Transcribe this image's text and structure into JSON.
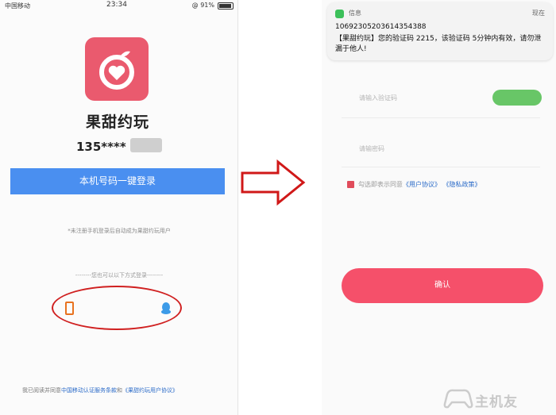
{
  "status_bar": {
    "carrier": "中国移动",
    "time": "23:34",
    "battery": "@ 91%"
  },
  "left_screen": {
    "app_name": "果甜约玩",
    "phone_number": "135****",
    "login_button": "本机号码一键登录",
    "auto_register_note": "*未注册手机登录后自动成为果甜约玩用户",
    "other_login_divider": "--------您也可以以下方式登录--------",
    "agreement": {
      "prefix": "我已阅读并同意",
      "link1": "中国移动认证服务条款",
      "middle": "和",
      "link2": "《果甜约玩用户协议》"
    },
    "icons": {
      "logo": "apple-heart-logo-icon",
      "phone_login": "phone-icon",
      "qq_login": "qq-penguin-icon"
    }
  },
  "sms": {
    "app": "信息",
    "time": "现在",
    "sender": "10692305203614354388",
    "body": "【果甜约玩】您的验证码 2215，该验证码 5分钟内有效，请勿泄漏于他人!"
  },
  "right_screen": {
    "code_placeholder": "请输入验证码",
    "password_placeholder": "请输密码",
    "agree_text": "勾选即表示同意",
    "agree_link1": "《用户协议》",
    "agree_link2": "《隐私政策》",
    "confirm_button": "确认"
  },
  "watermark": "主机友",
  "colors": {
    "brand_pink": "#ea5a6e",
    "login_blue": "#4a8ff0",
    "confirm_red": "#f5506a",
    "send_code_green": "#68c667",
    "annotation_red": "#d02020"
  }
}
